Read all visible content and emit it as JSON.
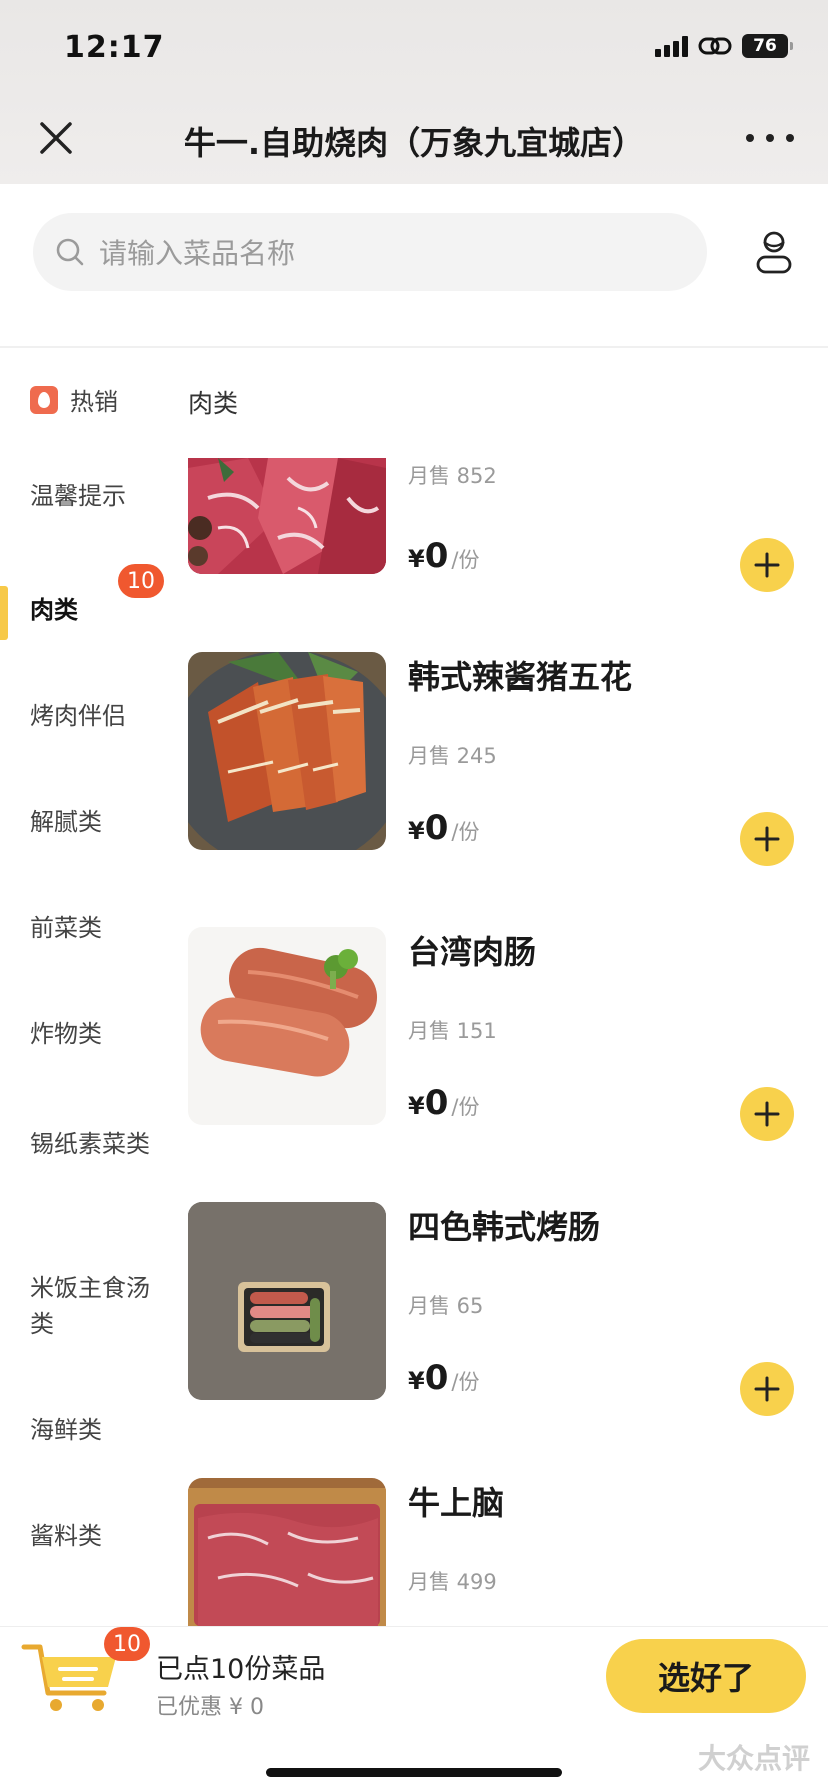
{
  "status_bar": {
    "time": "12:17",
    "battery": "76"
  },
  "nav": {
    "title": "牛一.自助烧肉（万象九宜城店）"
  },
  "search": {
    "placeholder": "请输入菜品名称"
  },
  "sidebar": {
    "hot_label": "热销",
    "active_badge": "10",
    "items": [
      {
        "label": "温馨提示"
      },
      {
        "label": "肉类"
      },
      {
        "label": "烤肉伴侣"
      },
      {
        "label": "解腻类"
      },
      {
        "label": "前菜类"
      },
      {
        "label": "炸物类"
      },
      {
        "label": "锡纸素菜类"
      },
      {
        "label": "米饭主食汤类"
      },
      {
        "label": "海鲜类"
      },
      {
        "label": "酱料类"
      }
    ]
  },
  "list": {
    "header": "肉类",
    "products": [
      {
        "name": "",
        "sales": "月售 852",
        "currency": "¥",
        "price": "0",
        "unit": "/份"
      },
      {
        "name": "韩式辣酱猪五花",
        "sales": "月售 245",
        "currency": "¥",
        "price": "0",
        "unit": "/份"
      },
      {
        "name": "台湾肉肠",
        "sales": "月售 151",
        "currency": "¥",
        "price": "0",
        "unit": "/份"
      },
      {
        "name": "四色韩式烤肠",
        "sales": "月售 65",
        "currency": "¥",
        "price": "0",
        "unit": "/份"
      },
      {
        "name": "牛上脑",
        "sales": "月售 499",
        "currency": "¥",
        "price": "",
        "unit": ""
      }
    ]
  },
  "cart": {
    "badge": "10",
    "summary": "已点10份菜品",
    "discount": "已优惠 ¥ 0",
    "checkout_label": "选好了"
  },
  "watermark": "大众点评",
  "colors": {
    "accent": "#f8d14c",
    "badge": "#f0582f",
    "active_bar": "#f7c948"
  }
}
